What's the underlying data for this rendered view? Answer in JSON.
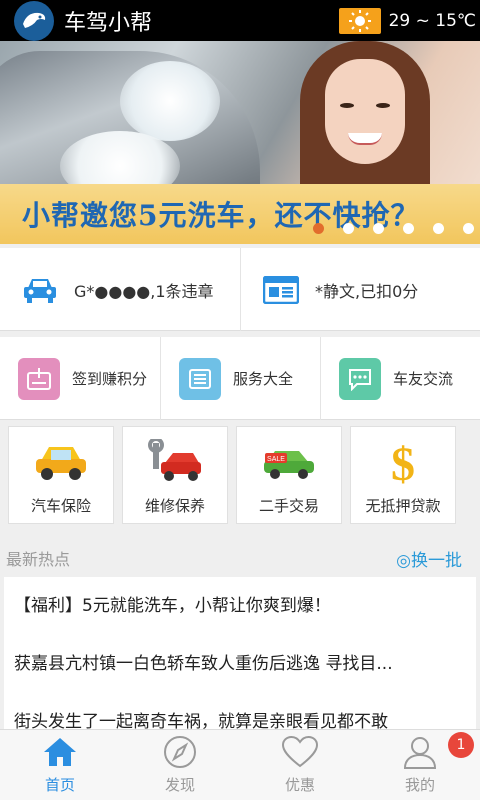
{
  "header": {
    "app_title": "车驾小帮",
    "logo_icon": "dolphin-logo-icon",
    "weather_icon": "sun-icon",
    "temperature": "29 ~ 15℃"
  },
  "banner": {
    "text": "小帮邀您5元洗车，还不快抢？",
    "slide_count": 6,
    "active_slide": 1
  },
  "info_row": [
    {
      "icon": "car-icon",
      "text": "G*●●●●,1条违章"
    },
    {
      "icon": "newspaper-icon",
      "text": "*静文,已扣0分"
    }
  ],
  "services": [
    {
      "icon": "sign-in-icon",
      "label": "签到赚积分",
      "color": "#e38fbd"
    },
    {
      "icon": "service-list-icon",
      "label": "服务大全",
      "color": "#6fc0e6"
    },
    {
      "icon": "chat-icon",
      "label": "车友交流",
      "color": "#5ec9a7"
    }
  ],
  "cards": [
    {
      "icon": "insurance-car-icon",
      "label": "汽车保险"
    },
    {
      "icon": "repair-wrench-icon",
      "label": "维修保养"
    },
    {
      "icon": "sale-car-icon",
      "label": "二手交易"
    },
    {
      "icon": "dollar-icon",
      "label": "无抵押贷款"
    }
  ],
  "hot": {
    "title": "最新热点",
    "refresh_label": "◎换一批",
    "news": [
      "【福利】5元就能洗车，小帮让你爽到爆！",
      "获嘉县亢村镇一白色轿车致人重伤后逃逸 寻找目...",
      "街头发生了一起离奇车祸，就算是亲眼看见都不敢"
    ]
  },
  "nav": [
    {
      "icon": "home-icon",
      "label": "首页",
      "active": true
    },
    {
      "icon": "compass-icon",
      "label": "发现",
      "active": false
    },
    {
      "icon": "heart-icon",
      "label": "优惠",
      "active": false
    },
    {
      "icon": "person-icon",
      "label": "我的",
      "active": false,
      "badge": "1"
    }
  ],
  "colors": {
    "accent": "#2b8ee0",
    "header_bg": "#000000",
    "banner_text": "#1f67b3",
    "badge": "#e8463b"
  }
}
